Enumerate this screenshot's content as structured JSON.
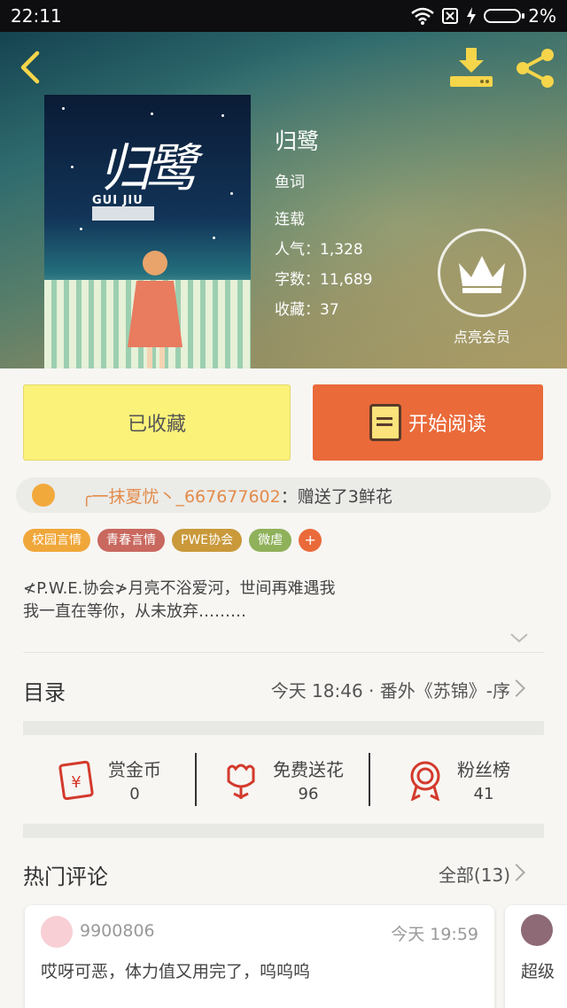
{
  "status_bar": {
    "time": "22:11",
    "battery": "2%"
  },
  "book": {
    "title": "归鹭",
    "author": "鱼词",
    "status": "连载",
    "popularity": "人气：1,328",
    "word_count": "字数：11,689",
    "favorites": "收藏：37",
    "cover_title": "归鹭",
    "cover_subtitle": "GUI JIU"
  },
  "vip": {
    "label": "点亮会员"
  },
  "buttons": {
    "collected": "已收藏",
    "start_reading": "开始阅读"
  },
  "gift": {
    "user": "╭一抹夏忧丶_667677602",
    "text": "：赠送了3鲜花"
  },
  "tags": [
    {
      "label": "校园言情",
      "color": "#f0a73a"
    },
    {
      "label": "青春言情",
      "color": "#c9685f"
    },
    {
      "label": "PWE协会",
      "color": "#c9993a"
    },
    {
      "label": "微虐",
      "color": "#8fb15a"
    }
  ],
  "tag_add": "+",
  "description": {
    "line1": "≮P.W.E.协会≯月亮不浴爱河，世间再难遇我",
    "line2": "我一直在等你，从未放弃………"
  },
  "toc": {
    "label": "目录",
    "latest": "今天 18:46 · 番外《苏锦》-序"
  },
  "actions": [
    {
      "label": "赏金币",
      "value": "0"
    },
    {
      "label": "免费送花",
      "value": "96"
    },
    {
      "label": "粉丝榜",
      "value": "41"
    }
  ],
  "hot_comments": {
    "label": "热门评论",
    "all": "全部(13)",
    "items": [
      {
        "user": "9900806",
        "time": "今天 19:59",
        "text": "哎呀可恶，体力值又用完了，呜呜呜"
      },
      {
        "text": "超级"
      }
    ]
  },
  "colors": {
    "accent_orange": "#ea6a3a",
    "collected_yellow": "#fbf27a",
    "icon_red": "#d33a2c"
  }
}
